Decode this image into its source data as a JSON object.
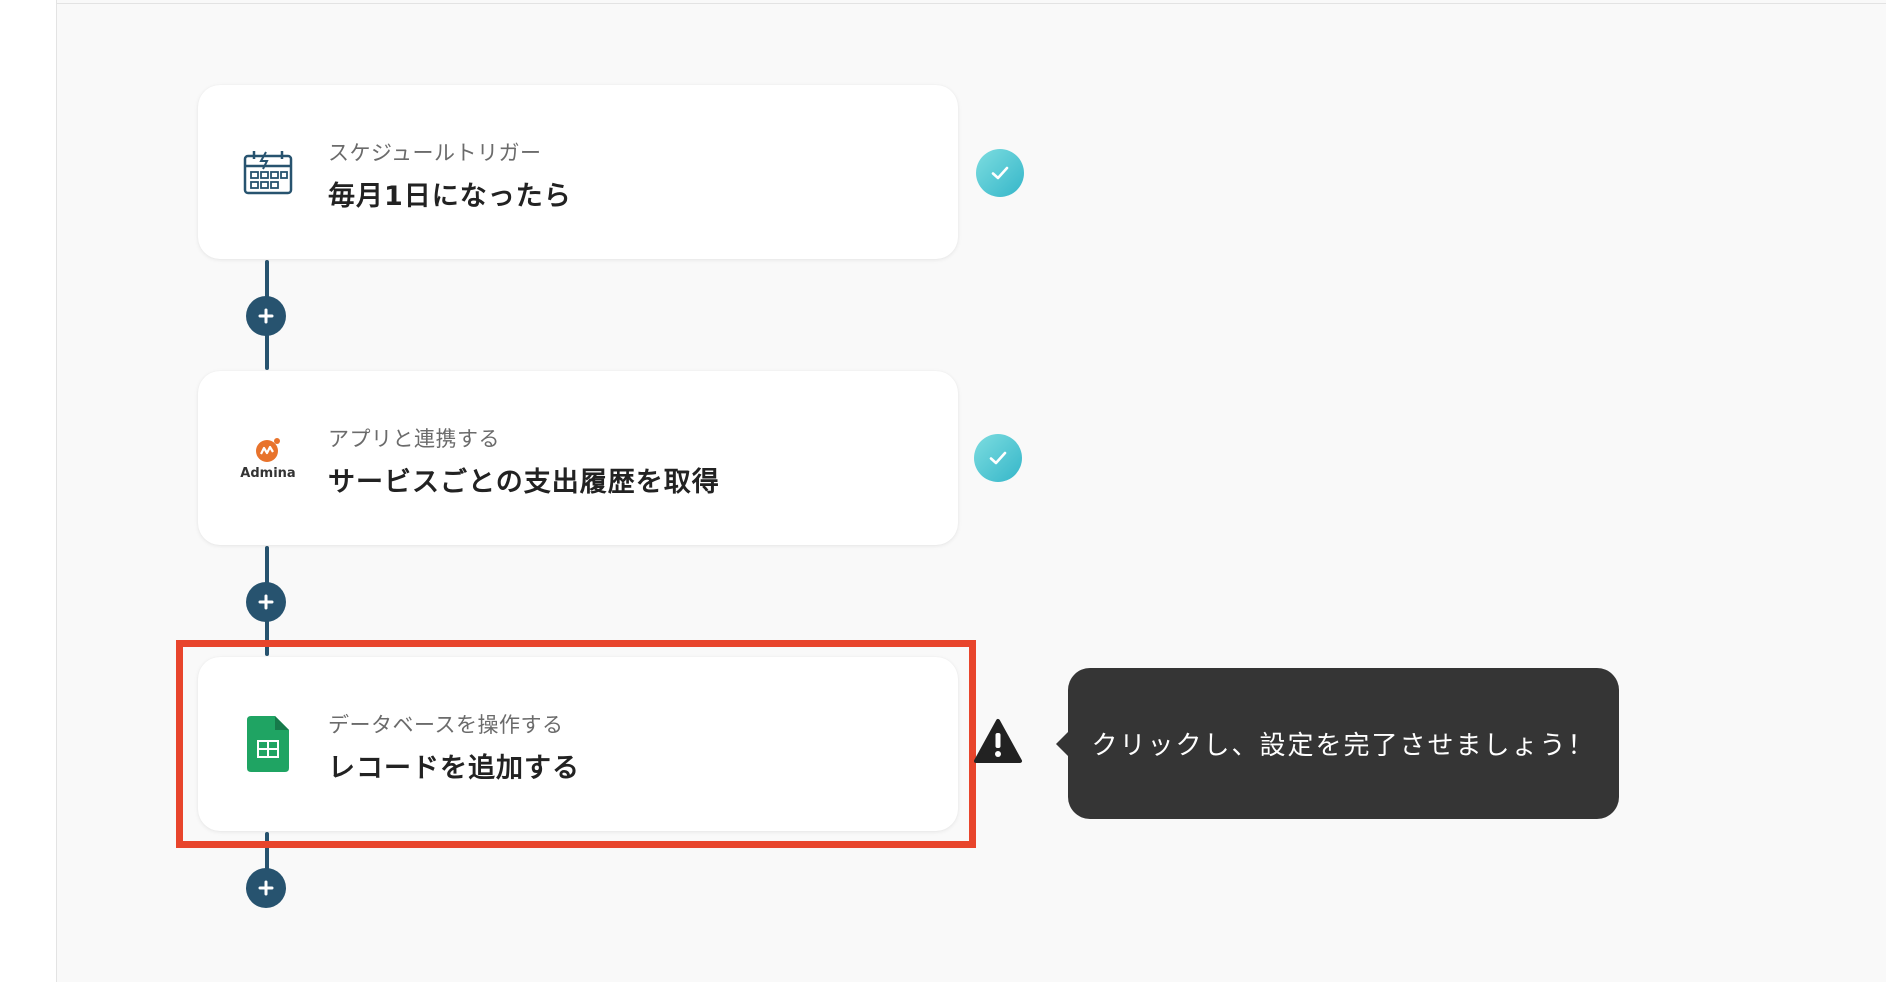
{
  "flow": {
    "steps": [
      {
        "subtitle": "スケジュールトリガー",
        "title": "毎月1日になったら",
        "icon": "schedule-calendar-icon",
        "status": "complete"
      },
      {
        "subtitle": "アプリと連携する",
        "title": "サービスごとの支出履歴を取得",
        "icon": "admina-logo-icon",
        "icon_label": "Admina",
        "status": "complete"
      },
      {
        "subtitle": "データベースを操作する",
        "title": "レコードを追加する",
        "icon": "google-sheets-icon",
        "status": "warning",
        "highlighted": true
      }
    ],
    "add_buttons": 3
  },
  "tooltip": {
    "text": "クリックし、設定を完了させましょう！"
  },
  "colors": {
    "connector": "#27536f",
    "check_gradient_start": "#7ddde0",
    "check_gradient_end": "#35b6c9",
    "highlight_border": "#e8452c",
    "tooltip_bg": "#353535",
    "sheets_green": "#1fa463",
    "admina_orange": "#e8732c",
    "schedule_icon": "#27536f"
  }
}
